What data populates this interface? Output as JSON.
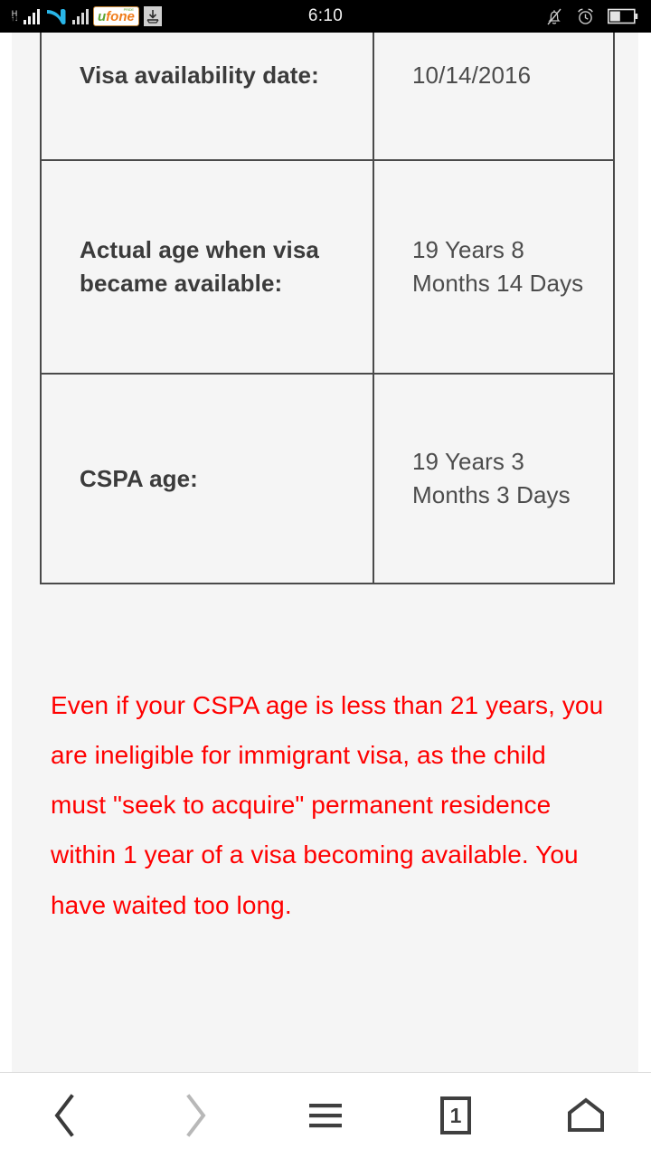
{
  "status_bar": {
    "network_type": "H",
    "carrier_primary_icon": "telenor-logo",
    "carrier_secondary_label": "ufone",
    "carrier_secondary_u": "u",
    "carrier_secondary_fone": "fone",
    "carrier_secondary_tm": "PRIDE",
    "download_icon": "download-icon",
    "clock": "6:10",
    "silent_icon": "bell-muted-icon",
    "alarm_icon": "alarm-clock-icon",
    "battery_icon": "battery-half-icon"
  },
  "page": {
    "table": {
      "rows": [
        {
          "label": "Visa availability date:",
          "value": "10/14/2016"
        },
        {
          "label": "Actual age when visa became available:",
          "value": "19 Years 8 Months 14 Days"
        },
        {
          "label": "CSPA age:",
          "value": "19 Years 3 Months 3 Days"
        }
      ]
    },
    "warning": {
      "text": "Even if your CSPA age is less than 21 years, you are ineligible for immigrant visa, as the child must \"seek to acquire\" permanent residence within 1 year of a visa becoming available. You have waited too long.",
      "color": "#ff0000"
    }
  },
  "toolbar": {
    "back_label": "back-chevron",
    "forward_label": "forward-chevron",
    "menu_label": "menu-hamburger",
    "tabs_count": "1",
    "home_label": "home-icon",
    "back_enabled": true,
    "forward_enabled": false
  },
  "colors": {
    "page_background": "#f5f5f5",
    "table_border": "#4a4a4a",
    "label_text": "#3b3b3b",
    "value_text": "#4c4c4c",
    "warning_text": "#ff0000",
    "status_bar_background": "#000000",
    "toolbar_background": "#ffffff",
    "toolbar_icon": "#3f3f3f",
    "toolbar_icon_disabled": "#b8b8b8"
  }
}
